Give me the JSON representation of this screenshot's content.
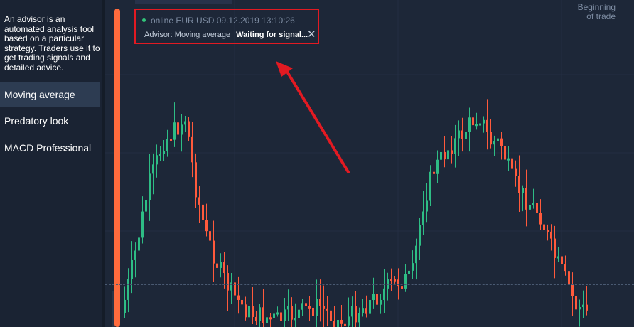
{
  "sidebar": {
    "description": "An advisor is an automated analysis tool based on a particular strategy. Traders use it to get trading signals and detailed advice.",
    "items": [
      {
        "label": "Moving average",
        "active": true
      },
      {
        "label": "Predatory look",
        "active": false
      },
      {
        "label": "MACD Professional",
        "active": false
      }
    ]
  },
  "advisor_panel": {
    "status": "online",
    "pair": "EUR USD",
    "datetime": "09.12.2019 13:10:26",
    "advisor_label": "Advisor: Moving average",
    "signal_text": "Waiting for signal...",
    "close_icon": "close-icon"
  },
  "chart": {
    "beginning_label_line1": "Beginning",
    "beginning_label_line2": "of trade",
    "colors": {
      "up": "#2ebd85",
      "down": "#ff5a3c",
      "trade_bar": "#ff6b3d",
      "highlight_border": "#e21a22",
      "arrow": "#e21a22"
    }
  }
}
